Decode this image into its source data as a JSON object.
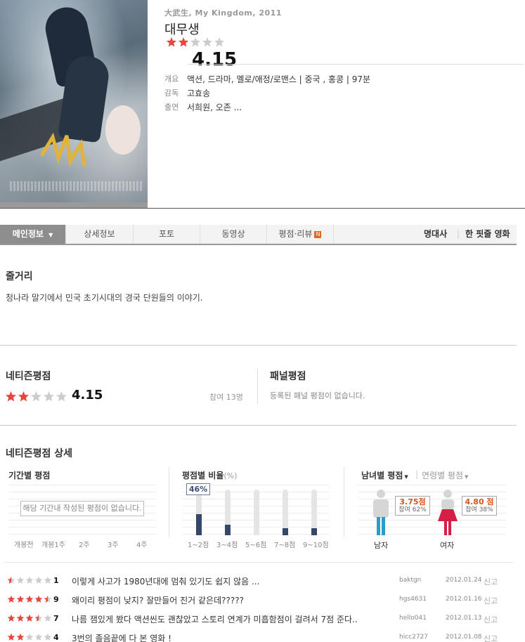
{
  "movie": {
    "title_en": "大武生, My Kingdom, 2011",
    "title": "대무생",
    "rating": "4.15",
    "rating_stars": 2.075,
    "info": [
      {
        "key": "개요",
        "value": "액션, 드라마, 멜로/애정/로맨스 | 중국 , 홍콩 | 97분"
      },
      {
        "key": "감독",
        "value": "고효송"
      },
      {
        "key": "출연",
        "value": "서희원, 오존 ..."
      }
    ]
  },
  "tabs": [
    {
      "label": "메인정보",
      "active": true
    },
    {
      "label": "상세정보"
    },
    {
      "label": "포토"
    },
    {
      "label": "동영상"
    },
    {
      "label": "평점·리뷰",
      "badge": "N"
    }
  ],
  "tabs_right": [
    "명대사",
    "한 핏줄 영화"
  ],
  "synopsis": {
    "title": "줄거리",
    "text": "청나라 말기에서 민국 초기시대의 경국 단원들의 이야기."
  },
  "netizen": {
    "title": "네티즌평점",
    "rating": "4.15",
    "rating_stars": 2.075,
    "participants": "참여 13명"
  },
  "panel": {
    "title": "패널평점",
    "empty": "등록된 패널 평점이 없습니다."
  },
  "detail": {
    "title": "네티즌평점 상세",
    "period": {
      "title": "기간별 평점",
      "empty": "해당 기간내 작성된 평점이 없습니다.",
      "labels": [
        "개봉전",
        "개봉1주",
        "2주",
        "3주",
        "4주"
      ]
    },
    "ratio": {
      "title": "평점별 비율",
      "unit": "(%)",
      "highlight": "46%",
      "bars": [
        {
          "label": "1~2점",
          "value": 46
        },
        {
          "label": "3~4점",
          "value": 23
        },
        {
          "label": "5~6점",
          "value": 0
        },
        {
          "label": "7~8점",
          "value": 15
        },
        {
          "label": "9~10점",
          "value": 15
        }
      ]
    },
    "gender": {
      "title": "남녀별 평점",
      "age_title": "연령별 평점",
      "male": {
        "label": "남자",
        "score": "3.75점",
        "share": "참여 62%"
      },
      "female": {
        "label": "여자",
        "score": "4.80 점",
        "share": "참여 38%"
      }
    }
  },
  "reviews": [
    {
      "stars": 0.5,
      "score": "1",
      "text": "이렇게 사고가 1980년대에 멈춰 있기도 쉽지 않음 ...",
      "user": "baktgn",
      "date": "2012.01.24",
      "report": "신고"
    },
    {
      "stars": 4.5,
      "score": "9",
      "text": "왜이리 평점이 낮지? 잘만들어 진거 같은데?????",
      "user": "hgs4631",
      "date": "2012.01.16",
      "report": "신고"
    },
    {
      "stars": 3.5,
      "score": "7",
      "text": "나름 잼있게 봤다 액션씬도 괜찮았고 스토리 연계가 미흡함점이 걸려서 7점 준다..",
      "user": "hello041",
      "date": "2012.01.13",
      "report": "신고"
    },
    {
      "stars": 2,
      "score": "4",
      "text": "3번의 졸음끝에 다 본 영화 !",
      "user": "hicc2727",
      "date": "2012.01.08",
      "report": "신고"
    }
  ],
  "colors": {
    "star_on": "#e8453c",
    "star_off": "#cccccc",
    "accent_orange": "#d9541e",
    "bar_navy": "#34466a"
  }
}
